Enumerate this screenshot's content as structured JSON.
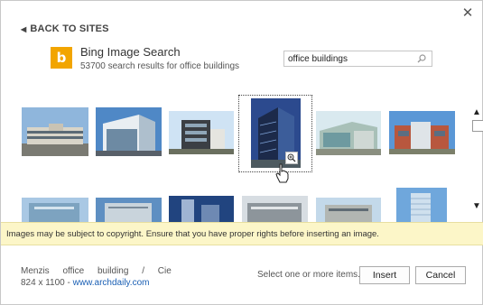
{
  "dialog": {
    "close_glyph": "✕",
    "back_label": "BACK TO SITES",
    "source_title": "Bing Image Search",
    "logo_letter": "b",
    "result_count": "53700 search results for office buildings",
    "search_value": "office buildings"
  },
  "copyright_notice": "Images may be subject to copyright. Ensure that you have proper rights before inserting an image.",
  "selected_info": {
    "name": "Menzis office building / Cie",
    "dims": "824 x 1100 - ",
    "link": "www.archdaily.com"
  },
  "footer": {
    "status": "Select one or more items.",
    "insert_label": "Insert",
    "cancel_label": "Cancel"
  },
  "colors": {
    "bing_orange": "#f2a500",
    "link_blue": "#1a5fb4",
    "notice_bg": "#fcf6c8"
  }
}
